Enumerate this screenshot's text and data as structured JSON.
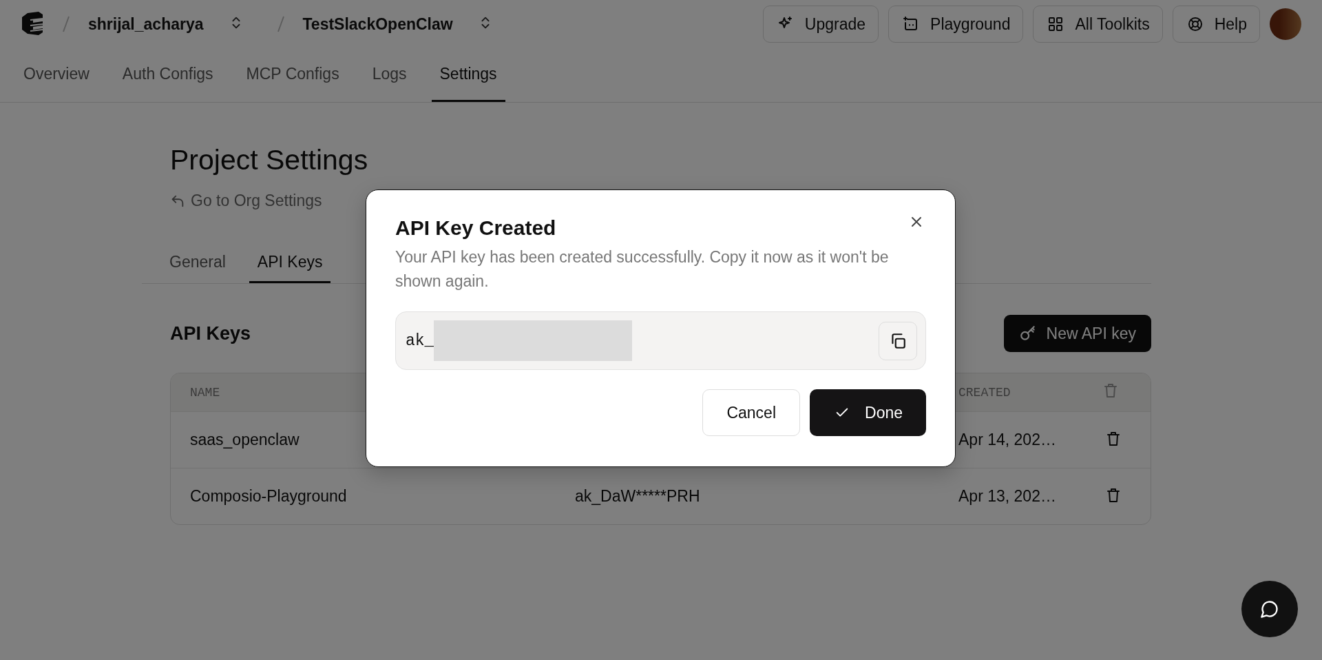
{
  "header": {
    "breadcrumbs": [
      {
        "label": "shrijal_acharya"
      },
      {
        "label": "TestSlackOpenClaw"
      }
    ],
    "buttons": [
      {
        "label": "Upgrade"
      },
      {
        "label": "Playground"
      },
      {
        "label": "All Toolkits"
      },
      {
        "label": "Help"
      }
    ]
  },
  "nav_tabs": [
    {
      "label": "Overview",
      "selected": false
    },
    {
      "label": "Auth Configs",
      "selected": false
    },
    {
      "label": "MCP Configs",
      "selected": false
    },
    {
      "label": "Logs",
      "selected": false
    },
    {
      "label": "Settings",
      "selected": true
    }
  ],
  "page": {
    "title": "Project Settings",
    "back_link": "Go to Org Settings",
    "sub_tabs": [
      {
        "label": "General",
        "selected": false
      },
      {
        "label": "API Keys",
        "selected": true
      }
    ],
    "section_title": "API Keys",
    "new_button": "New API key",
    "table": {
      "columns": [
        {
          "label": "NAME"
        },
        {
          "label": "CREATED"
        }
      ],
      "rows": [
        {
          "name": "saas_openclaw",
          "created": "Apr 14, 202…"
        },
        {
          "name": "Composio-Playground",
          "key": "ak_DaW*****PRH",
          "created": "Apr 13, 202…"
        }
      ]
    }
  },
  "modal": {
    "title": "API Key Created",
    "description": "Your API key has been created successfully. Copy it now as it won't be shown again.",
    "key_value": "ak_",
    "buttons": [
      {
        "label": "Cancel",
        "kind": "secondary"
      },
      {
        "label": "Done",
        "kind": "primary"
      }
    ]
  }
}
